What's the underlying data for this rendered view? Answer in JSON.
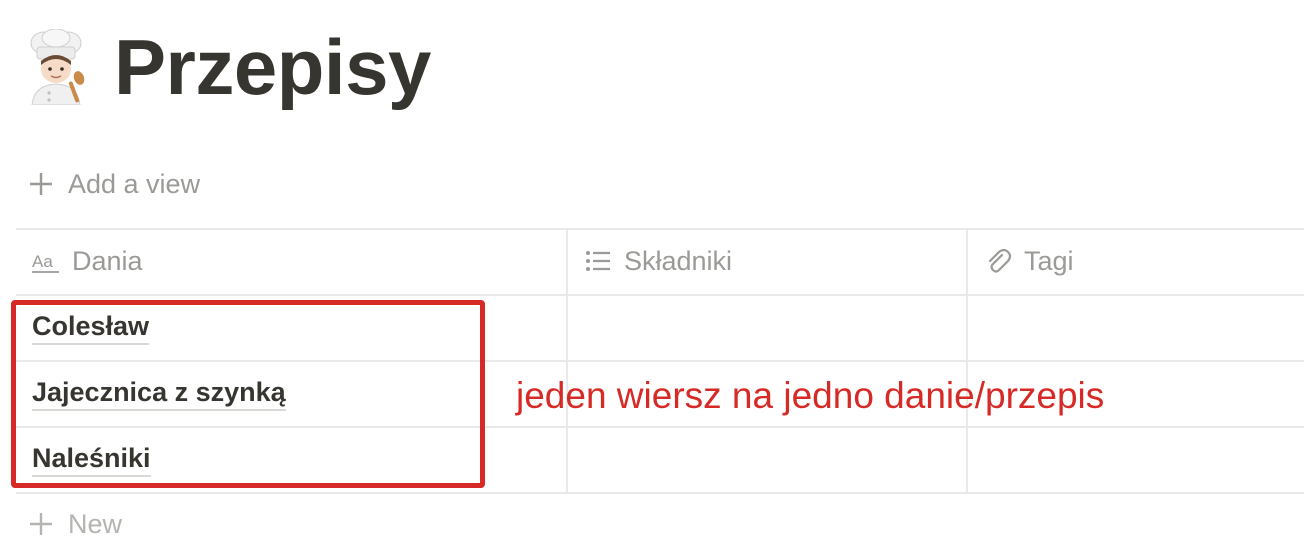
{
  "page": {
    "title": "Przepisy",
    "icon": "chef-emoji-icon"
  },
  "views": {
    "add_view_label": "Add a view",
    "add_view_icon": "plus-icon"
  },
  "table": {
    "columns": [
      {
        "label": "Dania",
        "icon": "text-property-icon"
      },
      {
        "label": "Składniki",
        "icon": "list-icon"
      },
      {
        "label": "Tagi",
        "icon": "paperclip-icon"
      }
    ],
    "rows": [
      {
        "dania": "Colesław",
        "skladniki": "",
        "tagi": ""
      },
      {
        "dania": "Jajecznica z szynką",
        "skladniki": "",
        "tagi": ""
      },
      {
        "dania": "Naleśniki",
        "skladniki": "",
        "tagi": ""
      }
    ],
    "new_label": "New",
    "new_icon": "plus-icon"
  },
  "annotation": {
    "text": "jeden wiersz na jedno danie/przepis",
    "color": "#d62a26"
  },
  "colors": {
    "text": "#37352f",
    "muted": "#9b9a97",
    "border": "#e9e9e7",
    "highlight": "#d62a26"
  }
}
